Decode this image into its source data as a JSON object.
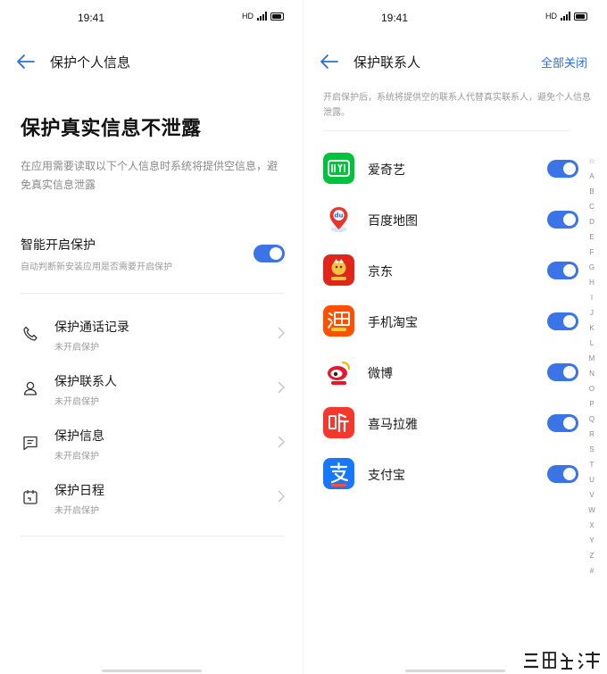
{
  "status": {
    "time": "19:41",
    "hd": "HD",
    "net": "4G"
  },
  "left": {
    "title": "保护个人信息",
    "heading": "保护真实信息不泄露",
    "description": "在应用需要读取以下个人信息时系统将提供空信息，避免真实信息泄露",
    "smart": {
      "label": "智能开启保护",
      "sub": "自动判断新安装应用是否需要开启保护",
      "on": true
    },
    "items": [
      {
        "label": "保护通话记录",
        "sub": "未开启保护",
        "icon": "phone-icon"
      },
      {
        "label": "保护联系人",
        "sub": "未开启保护",
        "icon": "contact-icon"
      },
      {
        "label": "保护信息",
        "sub": "未开启保护",
        "icon": "message-icon"
      },
      {
        "label": "保护日程",
        "sub": "未开启保护",
        "icon": "calendar-icon"
      }
    ]
  },
  "right": {
    "title": "保护联系人",
    "action": "全部关闭",
    "description": "开启保护后，系统将提供空的联系人代替真实联系人，避免个人信息泄露。",
    "apps": [
      {
        "name": "爱奇艺",
        "icon": "iqiyi-icon",
        "color": "#00c33c",
        "on": true
      },
      {
        "name": "百度地图",
        "icon": "baidu-map-icon",
        "color": "#e8352e",
        "on": true
      },
      {
        "name": "京东",
        "icon": "jd-icon",
        "color": "#e1251b",
        "on": true
      },
      {
        "name": "手机淘宝",
        "icon": "taobao-icon",
        "color": "#ff5000",
        "on": true
      },
      {
        "name": "微博",
        "icon": "weibo-icon",
        "color": "#f7b500",
        "on": true
      },
      {
        "name": "喜马拉雅",
        "icon": "ximalaya-icon",
        "color": "#f5382b",
        "on": true
      },
      {
        "name": "支付宝",
        "icon": "alipay-icon",
        "color": "#1677ff",
        "on": true
      }
    ],
    "index": [
      "☆",
      "A",
      "B",
      "C",
      "D",
      "E",
      "F",
      "G",
      "H",
      "I",
      "J",
      "K",
      "L",
      "M",
      "N",
      "O",
      "P",
      "Q",
      "R",
      "S",
      "T",
      "U",
      "V",
      "W",
      "X",
      "Y",
      "Z",
      "#"
    ]
  },
  "colors": {
    "accent": "#3a74e6",
    "link": "#2b6de0"
  }
}
